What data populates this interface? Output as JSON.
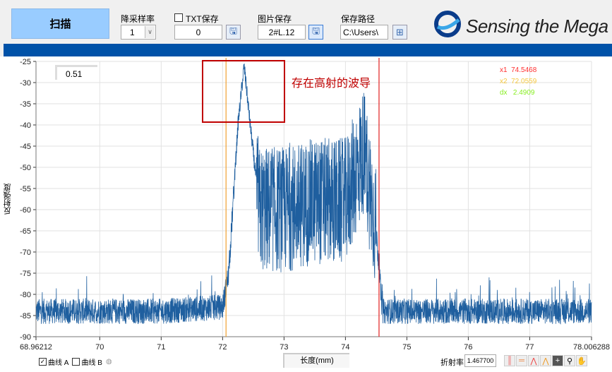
{
  "toolbar": {
    "scan_label": "扫描",
    "downsample": {
      "label": "降采样率",
      "value": "1"
    },
    "txt_save": {
      "label": "TXT保存",
      "checked": false,
      "value": "0"
    },
    "image_save": {
      "label": "图片保存",
      "value": "2#L.12"
    },
    "save_path": {
      "label": "保存路径",
      "value": "C:\\Users\\"
    }
  },
  "logo": {
    "text": "Sensing the Mega"
  },
  "colors": {
    "accent_bar": "#0052a8",
    "scan_button": "#99ccff",
    "trace": "#1f5f9f",
    "cursor1": "#e02020",
    "cursor2": "#f0a030",
    "annotation": "#c00000"
  },
  "chart": {
    "value_box": "0.51",
    "annotation": "存在高射的波导",
    "cursors": {
      "x1_label": "x1",
      "x1": "74.5468",
      "x2_label": "x2",
      "x2": "72.0559",
      "dx_label": "dx",
      "dx": "2.4909"
    },
    "ylabel": "反射强度",
    "xlabel": "长度(mm)"
  },
  "chart_data": {
    "type": "line",
    "ylabel": "反射强度",
    "xlabel": "长度(mm)",
    "xlim": [
      68.96212,
      78.006288
    ],
    "ylim": [
      -90,
      -25
    ],
    "x_ticks": [
      "68.96212",
      "70",
      "71",
      "72",
      "73",
      "74",
      "75",
      "76",
      "77",
      "78.006288"
    ],
    "y_ticks": [
      "-25",
      "-30",
      "-35",
      "-40",
      "-45",
      "-50",
      "-55",
      "-60",
      "-65",
      "-70",
      "-75",
      "-80",
      "-85",
      "-90"
    ],
    "grid": true,
    "series": [
      {
        "x": [
          68.96,
          70,
          71,
          72.0,
          72.1,
          72.25,
          72.35,
          72.45,
          72.6,
          73,
          73.5,
          74,
          74.3,
          74.5,
          74.6,
          75,
          76,
          77,
          78.0
        ],
        "y": [
          -84,
          -84,
          -84,
          -83,
          -75,
          -40,
          -26,
          -40,
          -60,
          -60,
          -58,
          -58,
          -46,
          -65,
          -84,
          -84,
          -84,
          -84,
          -84
        ]
      }
    ]
  },
  "bottom": {
    "curve_a": {
      "label": "曲线 A",
      "checked": true
    },
    "curve_b": {
      "label": "曲线 B",
      "checked": false
    },
    "refractive_label": "折射率",
    "refractive_value": "1.467700"
  }
}
